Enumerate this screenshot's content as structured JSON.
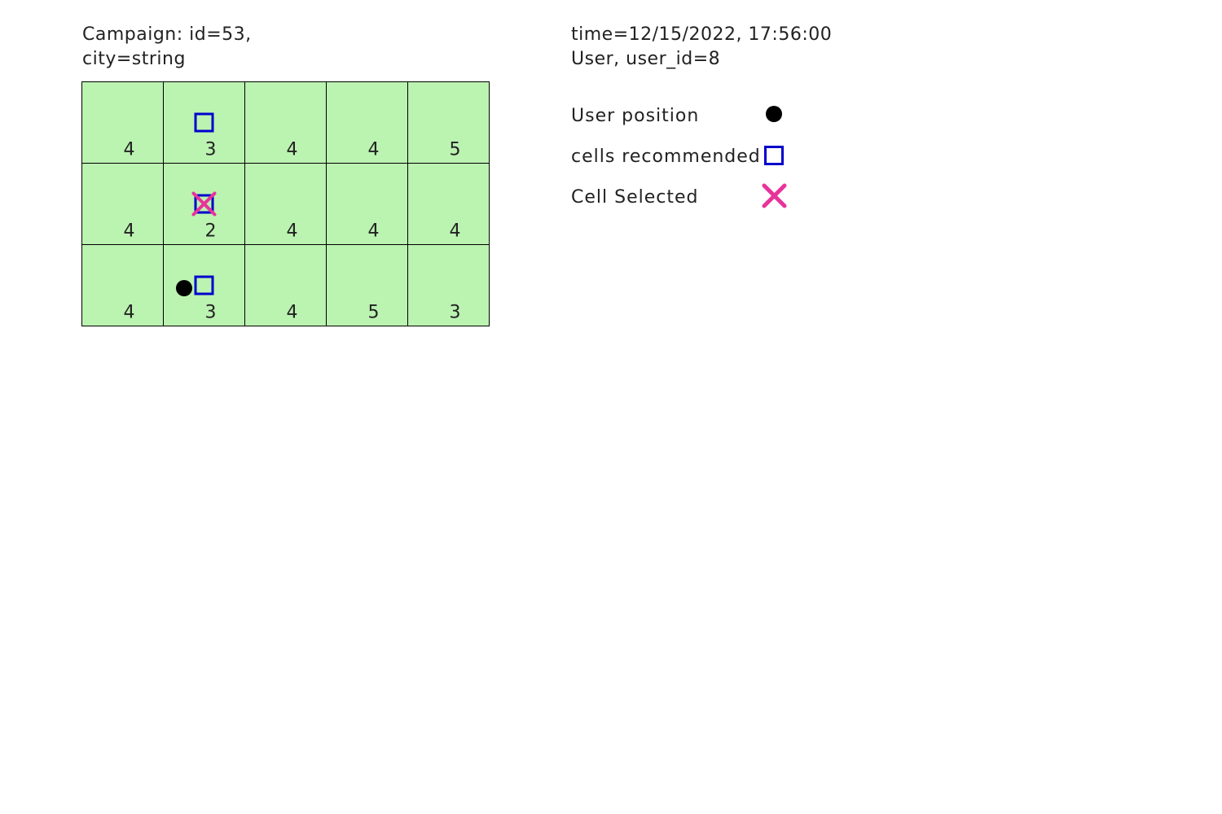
{
  "header": {
    "campaign_line1": "Campaign: id=53,",
    "campaign_line2": "city=string",
    "time_line": "time=12/15/2022, 17:56:00",
    "user_line": "User, user_id=8"
  },
  "legend": {
    "user_position_label": "User position",
    "recommended_label": "cells recommended",
    "selected_label": "Cell Selected"
  },
  "colors": {
    "cell_fill": "#bbf3b1",
    "grid_line": "#000000",
    "recommended": "#0000cc",
    "selected": "#e8339a",
    "user": "#000000"
  },
  "grid": {
    "rows": 3,
    "cols": 5,
    "values": [
      [
        4,
        3,
        4,
        4,
        5
      ],
      [
        4,
        2,
        4,
        4,
        4
      ],
      [
        4,
        3,
        4,
        5,
        3
      ]
    ],
    "recommended_cells": [
      [
        0,
        1
      ],
      [
        1,
        1
      ],
      [
        2,
        1
      ]
    ],
    "selected_cells": [
      [
        1,
        1
      ]
    ],
    "user_cell": [
      2,
      1
    ]
  }
}
